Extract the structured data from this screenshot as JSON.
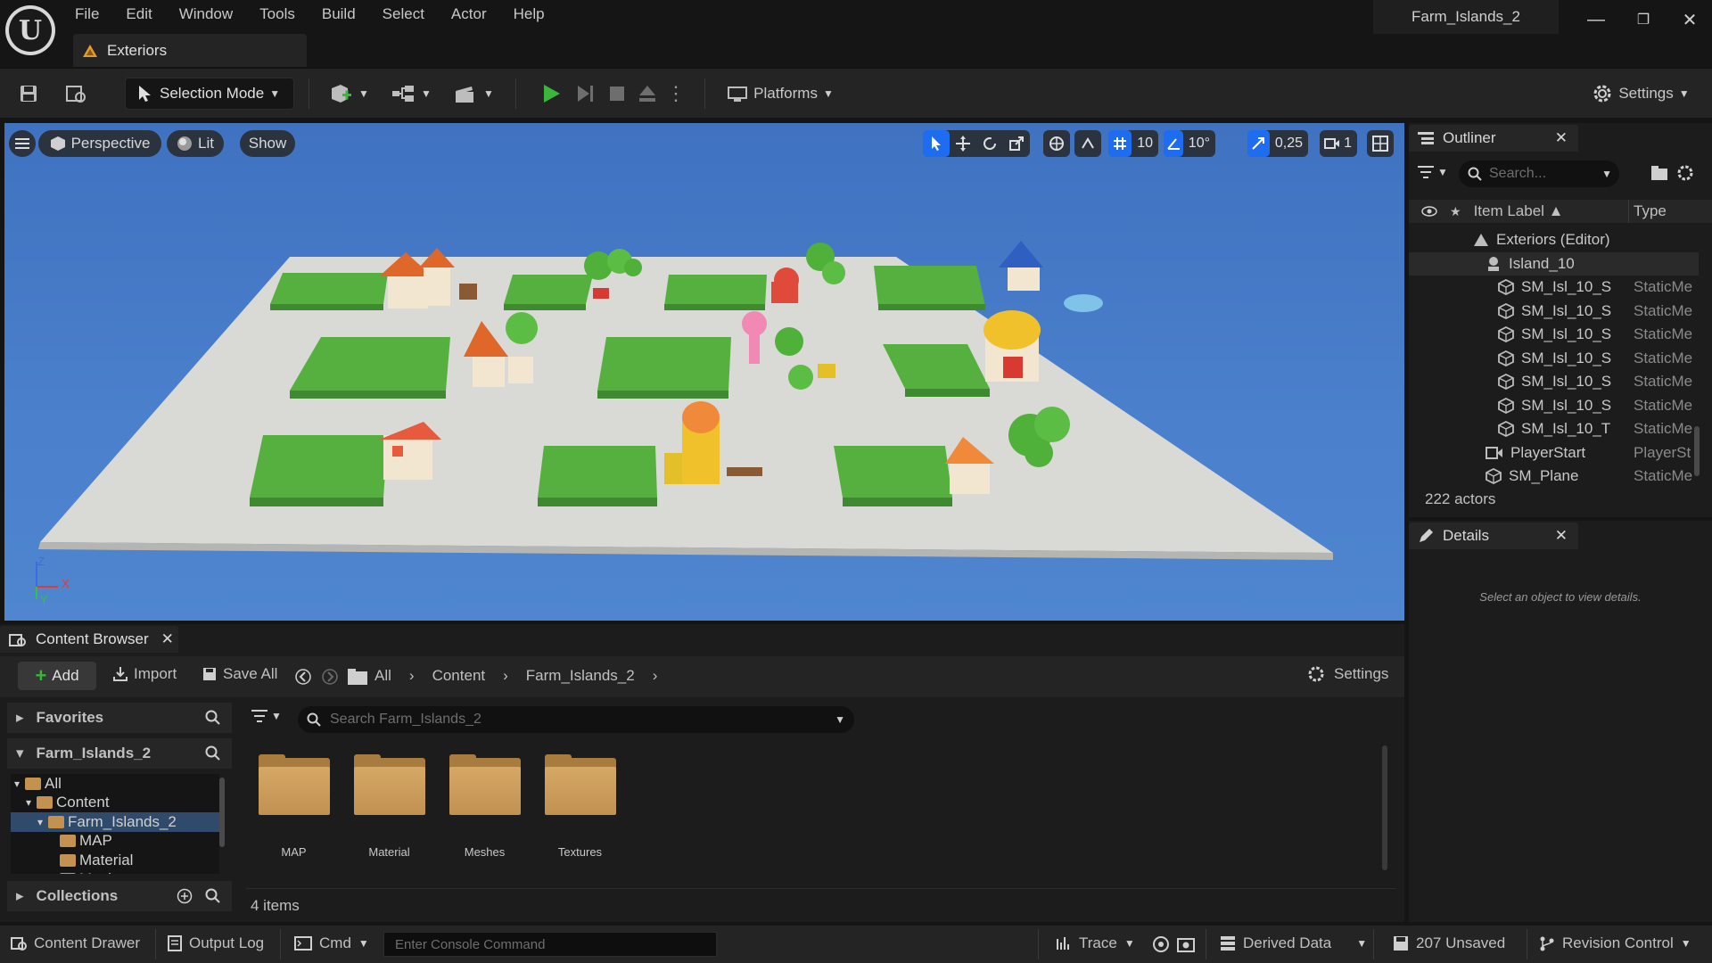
{
  "app": {
    "logo_letter": "U",
    "project_name": "Farm_Islands_2",
    "level_tab": "Exteriors",
    "menu": [
      "File",
      "Edit",
      "Window",
      "Tools",
      "Build",
      "Select",
      "Actor",
      "Help"
    ],
    "window_controls": {
      "minimize": "—",
      "restore": "❐",
      "close": "✕"
    }
  },
  "toolbar": {
    "selection_mode": "Selection Mode",
    "platforms": "Platforms",
    "settings": "Settings"
  },
  "viewport": {
    "perspective": "Perspective",
    "lit": "Lit",
    "show": "Show",
    "grid_snap": "10",
    "rotation_snap": "10°",
    "scale_snap": "0,25",
    "camera_speed": "1",
    "axis_labels": {
      "z": "Z",
      "x": "X",
      "y": "Y"
    }
  },
  "outliner": {
    "title": "Outliner",
    "search_placeholder": "Search...",
    "col_label": "Item Label ▲",
    "col_type": "Type",
    "rows": [
      {
        "label": "Exteriors (Editor)",
        "type": "",
        "indent": 1,
        "icon": "level-icon"
      },
      {
        "label": "Island_10",
        "type": "",
        "indent": 2,
        "icon": "actor-icon",
        "selected": true
      },
      {
        "label": "SM_Isl_10_S",
        "type": "StaticMe",
        "indent": 3,
        "icon": "static-mesh-icon"
      },
      {
        "label": "SM_Isl_10_S",
        "type": "StaticMe",
        "indent": 3,
        "icon": "static-mesh-icon"
      },
      {
        "label": "SM_Isl_10_S",
        "type": "StaticMe",
        "indent": 3,
        "icon": "static-mesh-icon"
      },
      {
        "label": "SM_Isl_10_S",
        "type": "StaticMe",
        "indent": 3,
        "icon": "static-mesh-icon"
      },
      {
        "label": "SM_Isl_10_S",
        "type": "StaticMe",
        "indent": 3,
        "icon": "static-mesh-icon"
      },
      {
        "label": "SM_Isl_10_S",
        "type": "StaticMe",
        "indent": 3,
        "icon": "static-mesh-icon"
      },
      {
        "label": "SM_Isl_10_T",
        "type": "StaticMe",
        "indent": 3,
        "icon": "static-mesh-icon"
      },
      {
        "label": "PlayerStart",
        "type": "PlayerSt",
        "indent": 2,
        "icon": "player-start-icon"
      },
      {
        "label": "SM_Plane",
        "type": "StaticMe",
        "indent": 2,
        "icon": "static-mesh-icon"
      }
    ],
    "actor_count": "222 actors"
  },
  "details": {
    "title": "Details",
    "empty_message": "Select an object to view details."
  },
  "content_browser": {
    "tab_title": "Content Browser",
    "add": "Add",
    "import": "Import",
    "save_all": "Save All",
    "breadcrumb": [
      "All",
      "Content",
      "Farm_Islands_2"
    ],
    "settings": "Settings",
    "favorites": "Favorites",
    "root_section": "Farm_Islands_2",
    "collections": "Collections",
    "search_placeholder": "Search Farm_Islands_2",
    "tree": [
      {
        "label": "All",
        "indent": 0
      },
      {
        "label": "Content",
        "indent": 1
      },
      {
        "label": "Farm_Islands_2",
        "indent": 2,
        "selected": true
      },
      {
        "label": "MAP",
        "indent": 3
      },
      {
        "label": "Material",
        "indent": 3
      },
      {
        "label": "Meshes",
        "indent": 3
      }
    ],
    "folders": [
      "MAP",
      "Material",
      "Meshes",
      "Textures"
    ],
    "item_count": "4 items"
  },
  "statusbar": {
    "content_drawer": "Content Drawer",
    "output_log": "Output Log",
    "cmd": "Cmd",
    "console_placeholder": "Enter Console Command",
    "trace": "Trace",
    "derived_data": "Derived Data",
    "unsaved": "207 Unsaved",
    "revision_control": "Revision Control"
  },
  "colors": {
    "accent_blue": "#1e6cf0",
    "play_green": "#3bb53b",
    "sky_blue": "#4a7fcc",
    "grass_green": "#4fae3c",
    "folder_tan": "#c89a56"
  }
}
